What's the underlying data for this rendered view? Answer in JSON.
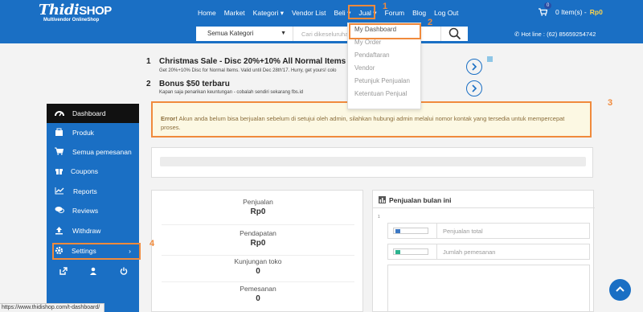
{
  "logo": {
    "brand_a": "Thidi",
    "brand_b": "SHOP",
    "tagline": "Multivendor OnlineShop"
  },
  "nav": {
    "items": [
      "Home",
      "Market",
      "Kategori",
      "Vendor List",
      "Beli",
      "Jual",
      "Forum",
      "Blog",
      "Log Out"
    ]
  },
  "cart": {
    "badge": "0",
    "items": "0 Item(s) -",
    "total": "Rp0"
  },
  "search": {
    "category": "Semua Kategori",
    "placeholder": "Cari dikeseluruhan..."
  },
  "hotline": "Hot line : (62) 85659254742",
  "dropdown": {
    "options": [
      "My Dashboard",
      "My Order",
      "Pendaftaran",
      "Vendor",
      "Petunjuk Penjualan",
      "Ketentuan Penjual"
    ]
  },
  "promos": [
    {
      "num": "1",
      "title": "Christmas Sale - Disc 20%+10% All Normal Items",
      "subtitle": "Get 20%+10% Disc for Normal Items. Valid until Dec 28th'17. Hurry, get yours! colo"
    },
    {
      "num": "2",
      "title": "Bonus $50 terbaru",
      "subtitle": "Kapan saja penarikan keuntungan - cobalah sendiri sekarang fbs.id"
    }
  ],
  "alert": {
    "label": "Error!",
    "message": " Akun anda belum bisa berjualan sebelum di setujui oleh admin, silahkan hubungi admin melalui nomor kontak yang tersedia untuk mempercepat proses."
  },
  "sidebar": {
    "items": [
      {
        "label": "Dashboard",
        "icon": "dashboard-icon"
      },
      {
        "label": "Produk",
        "icon": "product-icon"
      },
      {
        "label": "Semua pemesanan",
        "icon": "cart-icon"
      },
      {
        "label": "Coupons",
        "icon": "gift-icon"
      },
      {
        "label": "Reports",
        "icon": "chart-icon"
      },
      {
        "label": "Reviews",
        "icon": "comments-icon"
      },
      {
        "label": "Withdraw",
        "icon": "upload-icon"
      },
      {
        "label": "Settings",
        "icon": "gear-icon"
      }
    ]
  },
  "stats": [
    {
      "label": "Penjualan",
      "value": "Rp0"
    },
    {
      "label": "Pendapatan",
      "value": "Rp0"
    },
    {
      "label": "Kunjungan toko",
      "value": "0"
    },
    {
      "label": "Pemesanan",
      "value": "0"
    }
  ],
  "sales": {
    "title": "Penjualan bulan ini",
    "axis_tick": "1",
    "legend": [
      {
        "label": "Penjualan total",
        "color": "#3c78c4"
      },
      {
        "label": "Jumlah pemesanan",
        "color": "#2bb38e"
      }
    ]
  },
  "status_url": "https://www.thidishop.com/t-dashboard/",
  "annotations": [
    "1",
    "2",
    "3",
    "4"
  ],
  "colors": {
    "primary": "#1a6fc4",
    "accent": "#f08a3c",
    "alert_bg": "#fcf8e3",
    "cart_total": "#ffd54a"
  }
}
